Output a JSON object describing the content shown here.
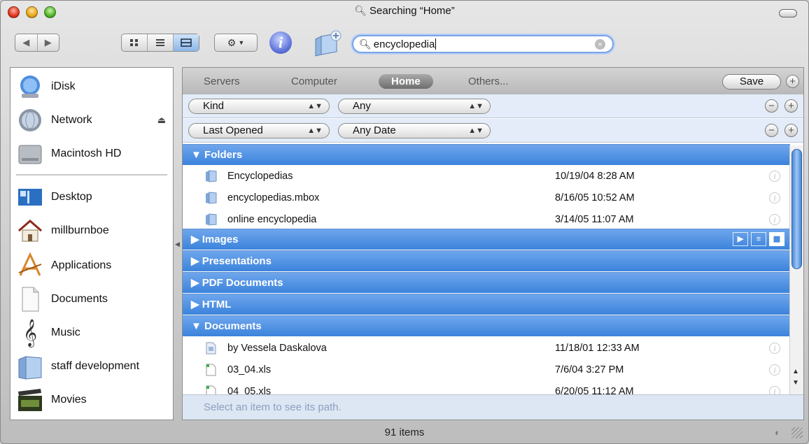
{
  "window": {
    "title": "Searching “Home”",
    "status": "91 items"
  },
  "toolbar": {
    "search_value": "encyclopedia",
    "view_options": [
      "icon-view",
      "list-view",
      "column-view"
    ],
    "active_view": "column-view",
    "action_icon": "gear-icon"
  },
  "sidebar": {
    "items": [
      {
        "label": "iDisk",
        "icon": "idisk-icon"
      },
      {
        "label": "Network",
        "icon": "network-icon"
      },
      {
        "label": "Macintosh HD",
        "icon": "harddisk-icon"
      },
      {
        "label": "Desktop",
        "icon": "desktop-icon"
      },
      {
        "label": "millburnboe",
        "icon": "home-icon"
      },
      {
        "label": "Applications",
        "icon": "applications-icon"
      },
      {
        "label": "Documents",
        "icon": "documents-icon"
      },
      {
        "label": "Music",
        "icon": "music-icon"
      },
      {
        "label": "staff development",
        "icon": "folder-icon"
      },
      {
        "label": "Movies",
        "icon": "movies-icon"
      }
    ]
  },
  "scope": {
    "servers": "Servers",
    "computer": "Computer",
    "home": "Home",
    "others": "Others...",
    "save": "Save"
  },
  "criteria": [
    {
      "attribute": "Kind",
      "value": "Any"
    },
    {
      "attribute": "Last Opened",
      "value": "Any Date"
    }
  ],
  "groups": {
    "folders": "Folders",
    "images": "Images",
    "presentations": "Presentations",
    "pdf": "PDF Documents",
    "html": "HTML",
    "documents": "Documents"
  },
  "folders": [
    {
      "name": "Encyclopedias",
      "date": "10/19/04 8:28 AM"
    },
    {
      "name": "encyclopedias.mbox",
      "date": "8/16/05 10:52 AM"
    },
    {
      "name": "online encyclopedia",
      "date": "3/14/05 11:07 AM"
    }
  ],
  "documents": [
    {
      "name": " by Vessela Daskalova",
      "date": "11/18/01 12:33 AM"
    },
    {
      "name": "03_04.xls",
      "date": "7/6/04 3:27 PM"
    },
    {
      "name": "04_05.xls",
      "date": "6/20/05 11:12 AM"
    }
  ],
  "pathbar": "Select an item to see its path.",
  "colors": {
    "group_header": "#3b83dc",
    "selection": "#7aa3e8"
  }
}
